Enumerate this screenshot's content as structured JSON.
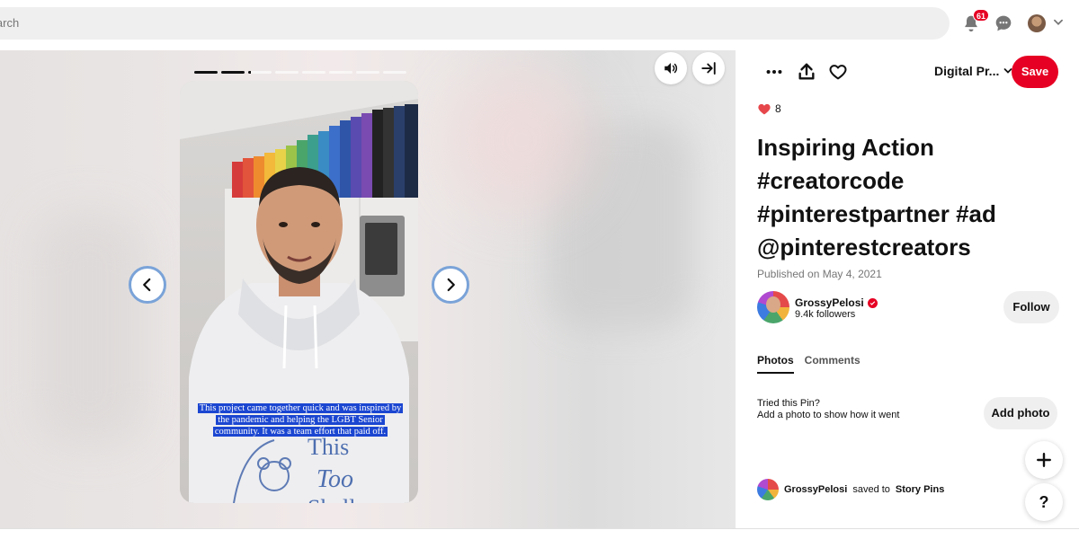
{
  "search": {
    "placeholder": "Search"
  },
  "header": {
    "notification_count": "61",
    "icons": [
      "bell-icon",
      "chat-icon",
      "avatar",
      "chevron-down-icon"
    ]
  },
  "story": {
    "segments_total": 8,
    "segments_completed": 2,
    "current_segment_progress": 0.1,
    "caption": "This project came together quick and was inspired by the pandemic and helping the LGBT Senior community. It was a team effort that paid off.",
    "shirt_text_line1": "This",
    "shirt_text_line2": "Too",
    "shirt_text_line3": "Shall"
  },
  "toolbar": {
    "board_name": "Digital Pr...",
    "save_label": "Save"
  },
  "pin": {
    "reaction_count": "8",
    "title": "Inspiring Action #creatorcode #pinterestpartner #ad @pinterestcreators",
    "published": "Published on May 4, 2021"
  },
  "creator": {
    "name": "GrossyPelosi",
    "followers": "9.4k followers",
    "follow_label": "Follow"
  },
  "tabs": [
    {
      "label": "Photos",
      "active": true
    },
    {
      "label": "Comments",
      "active": false
    }
  ],
  "tried": {
    "title": "Tried this Pin?",
    "subtitle": "Add a photo to show how it went",
    "button": "Add photo"
  },
  "activity": {
    "user": "GrossyPelosi",
    "verb": "saved to",
    "board": "Story Pins"
  },
  "fabs": {
    "plus": "+",
    "help": "?"
  },
  "colors": {
    "accent": "#e60023",
    "caption_bg": "#1b46d1",
    "nav_ring": "#7aa3d8"
  }
}
